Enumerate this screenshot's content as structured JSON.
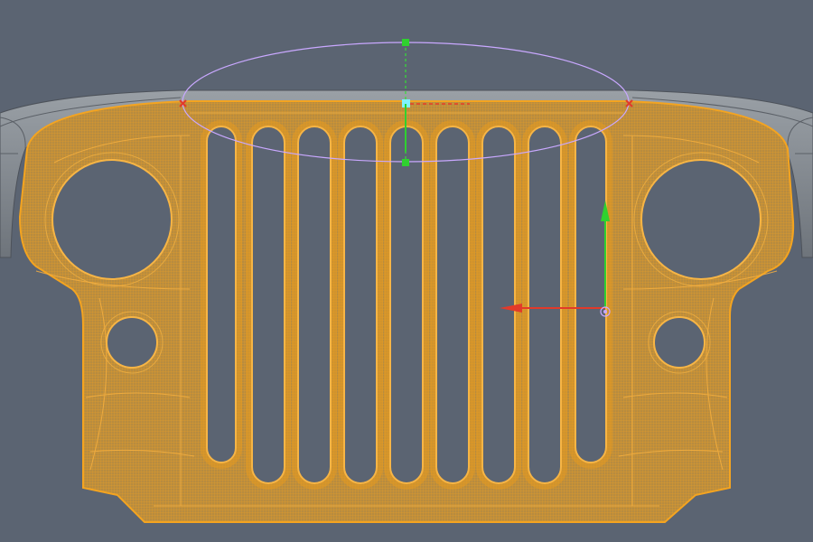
{
  "viewport": {
    "background": "#5b6472",
    "mesh_wire_color": "#f0a020",
    "mesh_fill_color": "#b58a3c",
    "fender_color": "#8a8f95",
    "selection_curve_color": "#c9a8ff",
    "gizmo_x_color": "#e23a2a",
    "gizmo_y_color": "#2fd12f",
    "gizmo_center_color": "#7ff3ff"
  },
  "model": {
    "object": "grille",
    "slot_count": 9,
    "headlight_count": 2,
    "turn_signal_count": 2
  },
  "gizmos": {
    "move_gizmo_icon": "move-arrows-icon",
    "control_point_icon": "square-handle-icon",
    "endpoint_icon": "x-marker-icon"
  }
}
